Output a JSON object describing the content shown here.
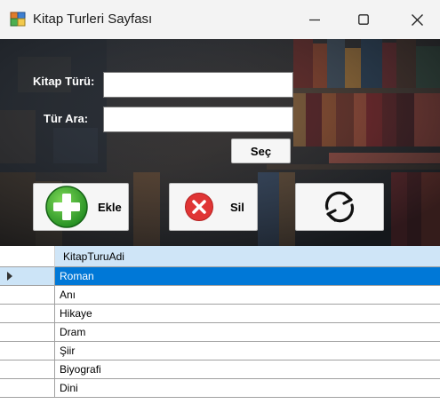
{
  "window": {
    "title": "Kitap Turleri Sayfası"
  },
  "form": {
    "kitap_turu_label": "Kitap Türü:",
    "kitap_turu_value": "",
    "tur_ara_label": "Tür Ara:",
    "tur_ara_value": "",
    "sec_label": "Seç"
  },
  "toolbar": {
    "ekle_label": "Ekle",
    "sil_label": "Sil",
    "refresh_icon": "refresh-icon",
    "add_icon": "plus-circle-icon",
    "delete_icon": "x-circle-icon"
  },
  "grid": {
    "column_header": "KitapTuruAdi",
    "selected_index": 0,
    "rows": [
      "Roman",
      "Anı",
      "Hikaye",
      "Dram",
      "Şiir",
      "Biyografi",
      "Dini"
    ]
  },
  "colors": {
    "selection": "#0078d7",
    "header_bg": "#cfe5f7",
    "add_green": "#2fa12f",
    "delete_red": "#e03535"
  }
}
